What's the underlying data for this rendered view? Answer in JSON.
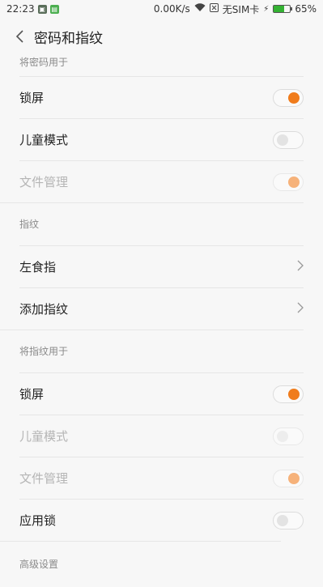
{
  "status": {
    "time": "22:23",
    "speed": "0.00K/s",
    "sim": "无SIM卡",
    "battery": "65%",
    "battery_level": 0.65
  },
  "header": {
    "title": "密码和指纹"
  },
  "sections": {
    "password_use": "将密码用于",
    "fingerprint": "指纹",
    "fingerprint_use": "将指纹用于",
    "advanced": "高级设置"
  },
  "password_use": {
    "lock_screen": "锁屏",
    "kids_mode": "儿童模式",
    "file_manager": "文件管理"
  },
  "fingerprint": {
    "left_index": "左食指",
    "add_fingerprint": "添加指纹"
  },
  "fingerprint_use": {
    "lock_screen": "锁屏",
    "kids_mode": "儿童模式",
    "file_manager": "文件管理",
    "app_lock": "应用锁"
  },
  "colors": {
    "accent": "#f07c1c",
    "accent_dim": "#f6b27a"
  }
}
